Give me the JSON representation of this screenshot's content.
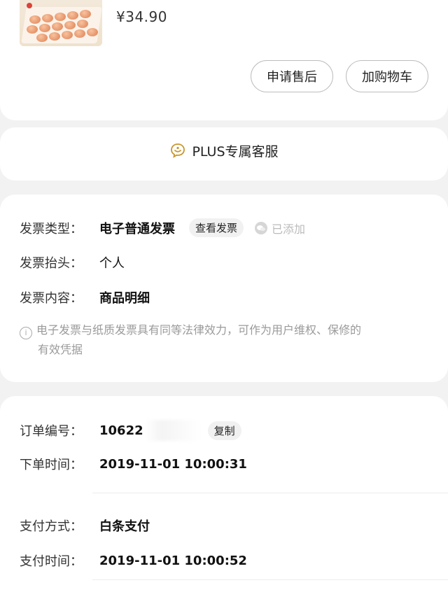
{
  "product": {
    "price": "¥34.90",
    "aftersale_label": "申请售后",
    "addcart_label": "加购物车"
  },
  "service": {
    "label": "PLUS专属客服",
    "icon": "chat-smile-icon",
    "accent": "#c9962e"
  },
  "invoice": {
    "type_label": "发票类型：",
    "type_value": "电子普通发票",
    "view_label": "查看发票",
    "added_label": "已添加",
    "title_label": "发票抬头：",
    "title_value": "个人",
    "content_label": "发票内容：",
    "content_value": "商品明细",
    "notice_line1": "电子发票与纸质发票具有同等法律效力，可作为用户维权、保修的",
    "notice_line2": "有效凭据"
  },
  "order": {
    "number_label": "订单编号：",
    "number_value": "10622",
    "copy_label": "复制",
    "order_time_label": "下单时间：",
    "order_time_value": "2019-11-01 10:00:31",
    "pay_method_label": "支付方式：",
    "pay_method_value": "白条支付",
    "pay_time_label": "支付时间：",
    "pay_time_value": "2019-11-01 10:00:52"
  }
}
